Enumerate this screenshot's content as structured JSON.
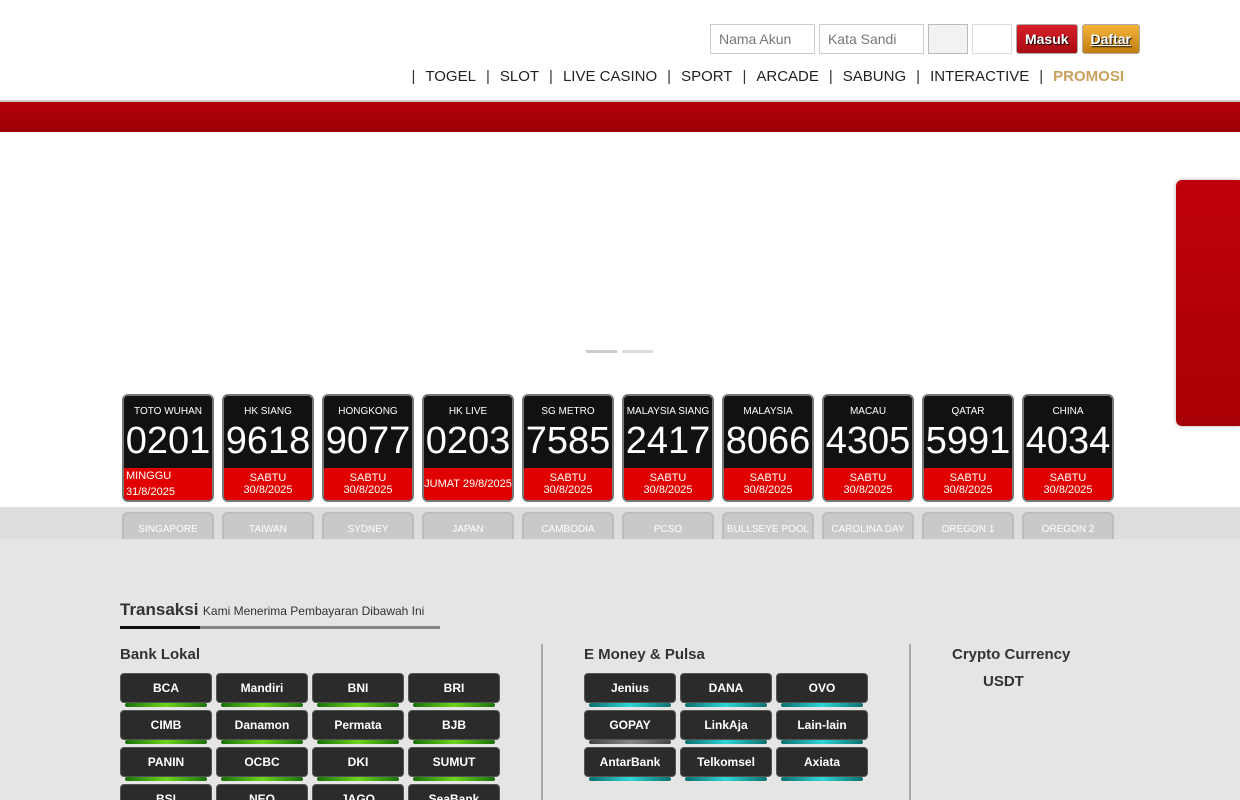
{
  "header": {
    "login": {
      "username_placeholder": "Nama Akun",
      "password_placeholder": "Kata Sandi",
      "login_label": "Masuk",
      "register_label": "Daftar"
    },
    "nav": [
      {
        "label": "TOGEL"
      },
      {
        "label": "SLOT"
      },
      {
        "label": "LIVE CASINO"
      },
      {
        "label": "SPORT"
      },
      {
        "label": "ARCADE"
      },
      {
        "label": "SABUNG"
      },
      {
        "label": "INTERACTIVE"
      },
      {
        "label": "PROMOSI"
      }
    ],
    "separator": "|"
  },
  "results": [
    {
      "market": "TOTO WUHAN",
      "number": "0201",
      "date": "MINGGU 31/8/2025"
    },
    {
      "market": "HK SIANG",
      "number": "9618",
      "date": "SABTU 30/8/2025"
    },
    {
      "market": "HONGKONG",
      "number": "9077",
      "date": "SABTU 30/8/2025"
    },
    {
      "market": "HK LIVE",
      "number": "0203",
      "date": "JUMAT 29/8/2025"
    },
    {
      "market": "SG METRO",
      "number": "7585",
      "date": "SABTU 30/8/2025"
    },
    {
      "market": "MALAYSIA SIANG",
      "number": "2417",
      "date": "SABTU 30/8/2025"
    },
    {
      "market": "MALAYSIA",
      "number": "8066",
      "date": "SABTU 30/8/2025"
    },
    {
      "market": "MACAU",
      "number": "4305",
      "date": "SABTU 30/8/2025"
    },
    {
      "market": "QATAR",
      "number": "5991",
      "date": "SABTU 30/8/2025"
    },
    {
      "market": "CHINA",
      "number": "4034",
      "date": "SABTU 30/8/2025"
    }
  ],
  "results_row2": [
    {
      "market": "SINGAPORE"
    },
    {
      "market": "TAIWAN"
    },
    {
      "market": "SYDNEY"
    },
    {
      "market": "JAPAN"
    },
    {
      "market": "CAMBODIA"
    },
    {
      "market": "PCSO"
    },
    {
      "market": "BULLSEYE POOL"
    },
    {
      "market": "CAROLINA DAY"
    },
    {
      "market": "OREGON 1"
    },
    {
      "market": "OREGON 2"
    }
  ],
  "transaksi": {
    "title": "Transaksi",
    "subtitle": "Kami Menerima Pembayaran Dibawah Ini"
  },
  "bank": {
    "title": "Bank Lokal",
    "items": [
      "BCA",
      "Mandiri",
      "BNI",
      "BRI",
      "CIMB",
      "Danamon",
      "Permata",
      "BJB",
      "PANIN",
      "OCBC",
      "DKI",
      "SUMUT",
      "BSI",
      "NEO",
      "JAGO",
      "SeaBank"
    ]
  },
  "emoney": {
    "title": "E Money & Pulsa",
    "items": [
      "Jenius",
      "DANA",
      "OVO",
      "GOPAY",
      "LinkAja",
      "Lain-lain",
      "AntarBank",
      "Telkomsel",
      "Axiata"
    ]
  },
  "crypto": {
    "title": "Crypto Currency",
    "items": [
      "USDT"
    ]
  }
}
